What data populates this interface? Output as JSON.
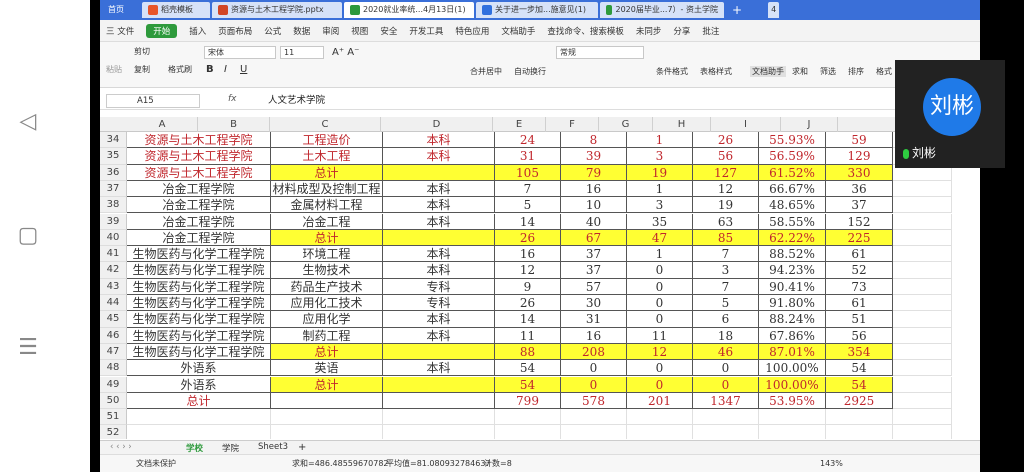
{
  "tabs": [
    {
      "label": "首页",
      "kind": "home"
    },
    {
      "label": "稻壳模板",
      "kind": "doc",
      "color": "#e8562a"
    },
    {
      "label": "资源与土木工程学院.pptx",
      "kind": "ppt",
      "color": "#d24625"
    },
    {
      "label": "2020就业率统...4月13日(1)",
      "kind": "sheet",
      "color": "#2e9a3c",
      "active": true
    },
    {
      "label": "关于进一步加...施意见(1)",
      "kind": "word",
      "color": "#2f6fde"
    },
    {
      "label": "2020届毕业...7）- 资土学院",
      "kind": "sheet",
      "color": "#2e9a3c"
    }
  ],
  "tab_count": "4",
  "menu": {
    "file": "三 文件",
    "items": [
      "开始",
      "插入",
      "页面布局",
      "公式",
      "数据",
      "审阅",
      "视图",
      "安全",
      "开发工具",
      "特色应用",
      "文档助手"
    ],
    "search": "查找命令、搜索模板",
    "sync": "未同步",
    "share": "分享",
    "comment": "批注"
  },
  "ribbon": {
    "cut": "剪切",
    "copy": "复制",
    "format_painter": "格式刷",
    "paste": "粘贴",
    "font": "宋体",
    "size": "11",
    "merge": "合并居中",
    "wrap": "自动换行",
    "number_format": "常规",
    "cond_format": "条件格式",
    "table_style": "表格样式",
    "doc_helper": "文档助手",
    "sum": "求和",
    "filter": "筛选",
    "sort": "排序",
    "format": "格式"
  },
  "formula_bar": {
    "cell": "A15",
    "fx": "fx",
    "value": "人文艺术学院"
  },
  "columns": [
    "A",
    "B",
    "C",
    "D",
    "E",
    "F",
    "G",
    "H",
    "I",
    "J"
  ],
  "rows": [
    {
      "n": "34",
      "c": [
        "资源与土木工程学院",
        "工程造价",
        "本科",
        "24",
        "8",
        "1",
        "26",
        "55.93%",
        "59"
      ],
      "style": "red"
    },
    {
      "n": "35",
      "c": [
        "资源与土木工程学院",
        "土木工程",
        "本科",
        "31",
        "39",
        "3",
        "56",
        "56.59%",
        "129"
      ],
      "style": "red"
    },
    {
      "n": "36",
      "c": [
        "资源与土木工程学院",
        "总计",
        "",
        "105",
        "79",
        "19",
        "127",
        "61.52%",
        "330"
      ],
      "style": "red-total"
    },
    {
      "n": "37",
      "c": [
        "冶金工程学院",
        "材料成型及控制工程",
        "本科",
        "7",
        "16",
        "1",
        "12",
        "66.67%",
        "36"
      ]
    },
    {
      "n": "38",
      "c": [
        "冶金工程学院",
        "金属材料工程",
        "本科",
        "5",
        "10",
        "3",
        "19",
        "48.65%",
        "37"
      ]
    },
    {
      "n": "39",
      "c": [
        "冶金工程学院",
        "冶金工程",
        "本科",
        "14",
        "40",
        "35",
        "63",
        "58.55%",
        "152"
      ]
    },
    {
      "n": "40",
      "c": [
        "冶金工程学院",
        "总计",
        "",
        "26",
        "67",
        "47",
        "85",
        "62.22%",
        "225"
      ],
      "style": "total"
    },
    {
      "n": "41",
      "c": [
        "生物医药与化学工程学院",
        "环境工程",
        "本科",
        "16",
        "37",
        "1",
        "7",
        "88.52%",
        "61"
      ]
    },
    {
      "n": "42",
      "c": [
        "生物医药与化学工程学院",
        "生物技术",
        "本科",
        "12",
        "37",
        "0",
        "3",
        "94.23%",
        "52"
      ]
    },
    {
      "n": "43",
      "c": [
        "生物医药与化学工程学院",
        "药品生产技术",
        "专科",
        "9",
        "57",
        "0",
        "7",
        "90.41%",
        "73"
      ]
    },
    {
      "n": "44",
      "c": [
        "生物医药与化学工程学院",
        "应用化工技术",
        "专科",
        "26",
        "30",
        "0",
        "5",
        "91.80%",
        "61"
      ]
    },
    {
      "n": "45",
      "c": [
        "生物医药与化学工程学院",
        "应用化学",
        "本科",
        "14",
        "31",
        "0",
        "6",
        "88.24%",
        "51"
      ]
    },
    {
      "n": "46",
      "c": [
        "生物医药与化学工程学院",
        "制药工程",
        "本科",
        "11",
        "16",
        "11",
        "18",
        "67.86%",
        "56"
      ]
    },
    {
      "n": "47",
      "c": [
        "生物医药与化学工程学院",
        "总计",
        "",
        "88",
        "208",
        "12",
        "46",
        "87.01%",
        "354"
      ],
      "style": "total"
    },
    {
      "n": "48",
      "c": [
        "外语系",
        "英语",
        "本科",
        "54",
        "0",
        "0",
        "0",
        "100.00%",
        "54"
      ]
    },
    {
      "n": "49",
      "c": [
        "外语系",
        "总计",
        "",
        "54",
        "0",
        "0",
        "0",
        "100.00%",
        "54"
      ],
      "style": "total"
    },
    {
      "n": "50",
      "c": [
        "总计",
        "",
        "",
        "799",
        "578",
        "201",
        "1347",
        "53.95%",
        "2925"
      ],
      "style": "grand"
    },
    {
      "n": "51",
      "c": [
        "",
        "",
        "",
        "",
        "",
        "",
        "",
        "",
        ""
      ],
      "style": "blank"
    },
    {
      "n": "52",
      "c": [
        "",
        "",
        "",
        "",
        "",
        "",
        "",
        "",
        ""
      ],
      "style": "blank"
    }
  ],
  "sheets": [
    "学校",
    "学院",
    "Sheet3"
  ],
  "status": {
    "protect": "文档未保护",
    "sum": "求和=486.48559670782",
    "avg": "平均值=81.080932784637",
    "count": "计数=8",
    "zoom": "143%"
  },
  "video": {
    "avatar_text": "刘彬",
    "name": "刘彬"
  }
}
